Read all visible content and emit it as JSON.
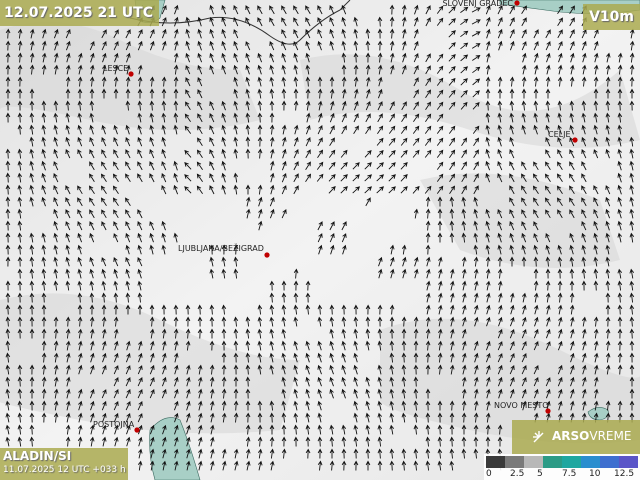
{
  "header": {
    "title": "12.07.2025 21 UTC",
    "variable": "V10m"
  },
  "model": {
    "name": "ALADIN/SI",
    "run": "11.07.2025 12 UTC +033 h"
  },
  "logo": {
    "icon": "arso-sun-icon",
    "text_bold": "ARSO",
    "text_light": "VREME"
  },
  "legend": {
    "colors": [
      "#3a3a3a",
      "#7a7a7a",
      "#b8b8b8",
      "#2c9b86",
      "#1fa7a0",
      "#2a8ecf",
      "#3e6fcf",
      "#5a55c8"
    ],
    "ticks": [
      "0",
      "2.5",
      "5",
      "7.5",
      "10",
      "12.5"
    ]
  },
  "places": [
    {
      "name": "SLOVENJ GRADEC"
    },
    {
      "name": "LESCE"
    },
    {
      "name": "CELJE"
    },
    {
      "name": "LJUBLJANA/BEŽIGRAD"
    },
    {
      "name": "NOVO MESTO"
    },
    {
      "name": "POSTOJNA"
    }
  ],
  "colors": {
    "panel": "#aaaa50",
    "marker": "#c00000",
    "water": "#a8cfc6"
  }
}
